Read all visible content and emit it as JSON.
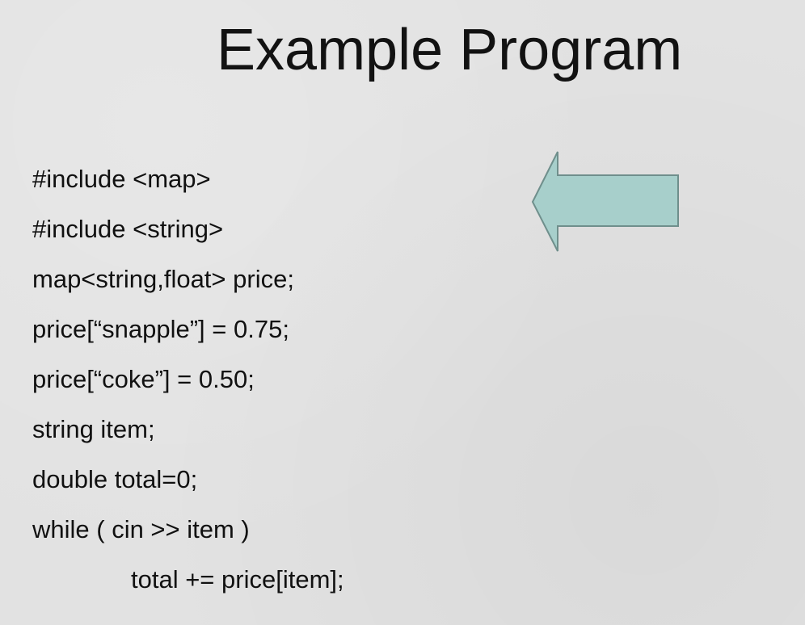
{
  "slide": {
    "title": "Example Program",
    "code_lines": [
      "#include <map>",
      "#include <string>",
      "map<string,float> price;",
      "price[“snapple”] = 0.75;",
      "price[“coke”] = 0.50;",
      "string item;",
      "double total=0;",
      "while ( cin >> item )",
      "total += price[item];"
    ],
    "arrow": {
      "direction": "left",
      "fill": "#a7cfcb",
      "stroke": "#6f8f8c"
    }
  }
}
